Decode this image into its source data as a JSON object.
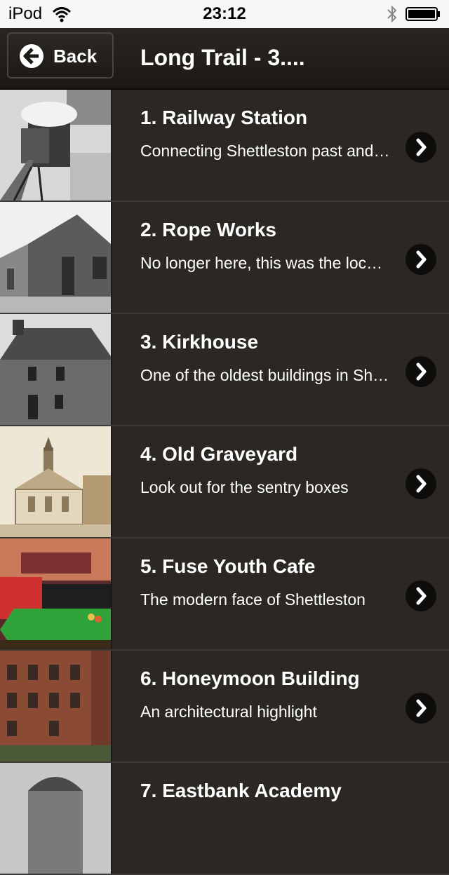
{
  "status_bar": {
    "carrier": "iPod",
    "time": "23:12"
  },
  "nav": {
    "back_label": "Back",
    "title": "Long Trail - 3...."
  },
  "colors": {
    "background": "#2b2824",
    "nav_background": "#1f1c18",
    "text": "#ffffff",
    "chevron_bg": "#0f0d0b"
  },
  "items": [
    {
      "title": "1. Railway Station",
      "subtitle": "Connecting Shettleston past and present",
      "icon": "railway-station-photo"
    },
    {
      "title": "2. Rope Works",
      "subtitle": "No longer here, this was the location of the rope works",
      "icon": "rope-works-photo"
    },
    {
      "title": "3. Kirkhouse",
      "subtitle": "One of the oldest buildings in Shettleston",
      "icon": "kirkhouse-photo"
    },
    {
      "title": "4. Old Graveyard",
      "subtitle": "Look out for the sentry boxes",
      "icon": "old-graveyard-sketch"
    },
    {
      "title": "5. Fuse Youth Cafe",
      "subtitle": "The modern face of Shettleston",
      "icon": "fuse-youth-cafe-photo"
    },
    {
      "title": "6. Honeymoon Building",
      "subtitle": "An architectural highlight",
      "icon": "honeymoon-building-photo"
    },
    {
      "title": "7. Eastbank Academy",
      "subtitle": "",
      "icon": "eastbank-academy-photo"
    }
  ]
}
